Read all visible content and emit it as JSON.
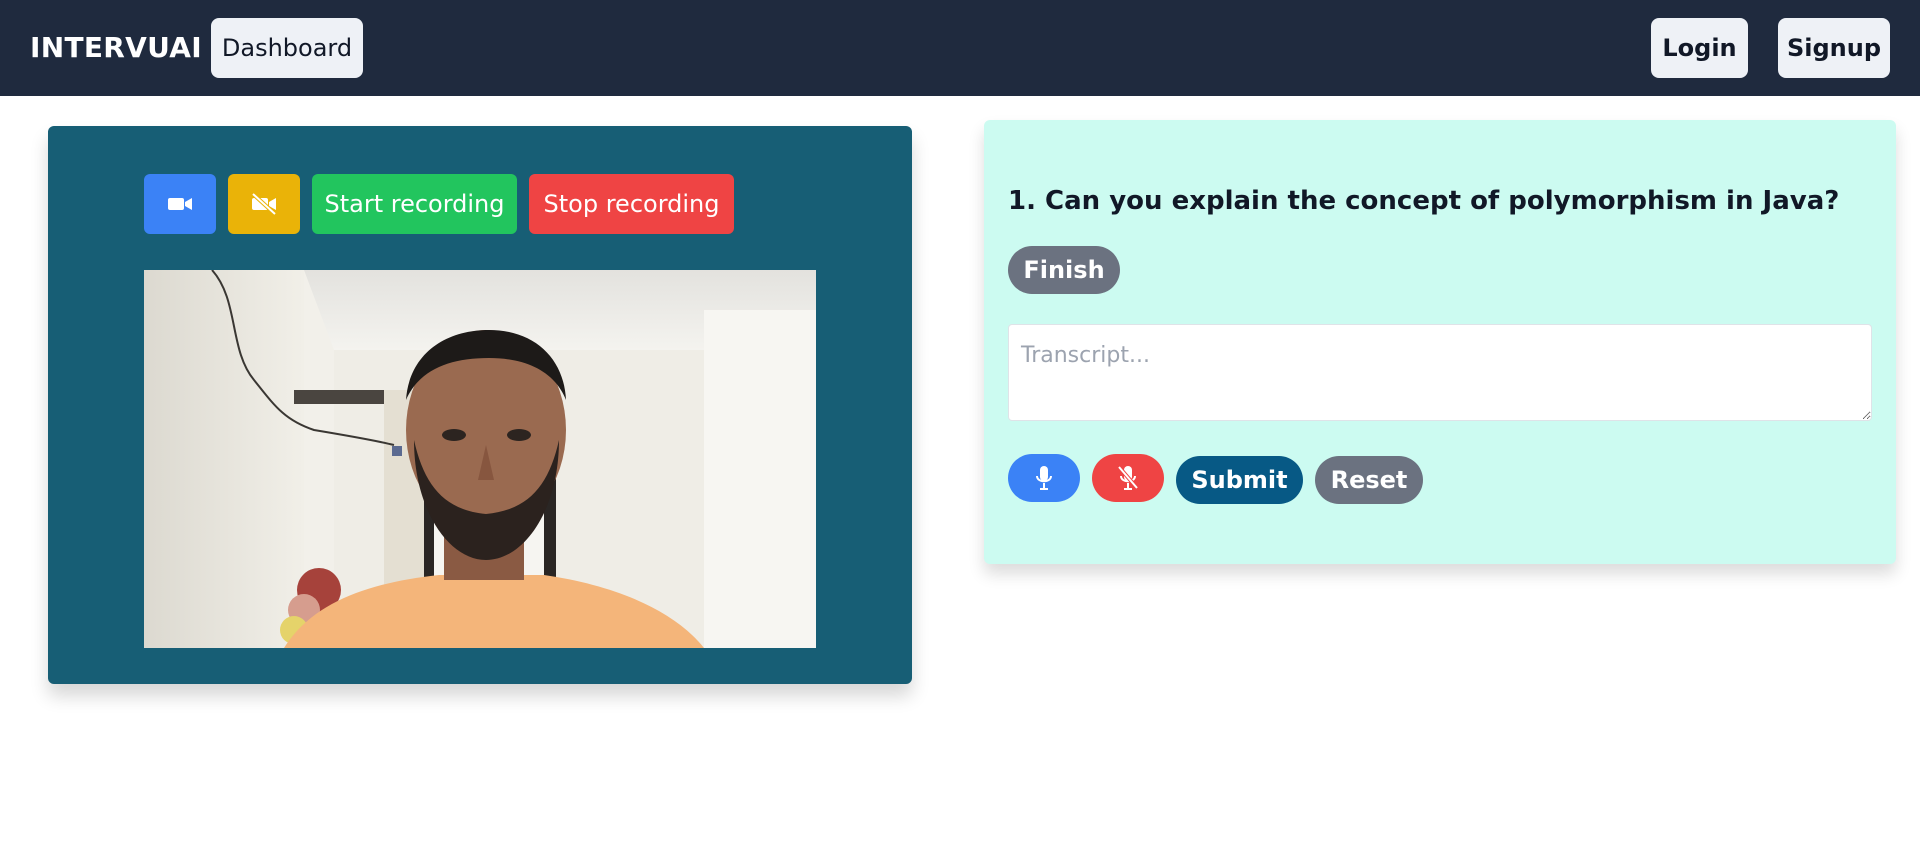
{
  "navbar": {
    "brand": "INTERVUAI",
    "dashboard_label": "Dashboard",
    "login_label": "Login",
    "signup_label": "Signup",
    "background": "#1f2a3e"
  },
  "video_panel": {
    "background": "#175e75",
    "camera_on_icon": "video-camera-icon",
    "camera_off_icon": "video-camera-off-icon",
    "start_recording_label": "Start recording",
    "stop_recording_label": "Stop recording",
    "feed_description": "webcam-feed"
  },
  "question_panel": {
    "background": "#ccfbf1",
    "question": "1. Can you explain the concept of polymorphism in Java?",
    "finish_label": "Finish",
    "transcript_placeholder": "Transcript...",
    "mic_on_icon": "microphone-icon",
    "mic_off_icon": "microphone-off-icon",
    "submit_label": "Submit",
    "reset_label": "Reset"
  },
  "colors": {
    "primary_blue": "#3b82f6",
    "yellow": "#eab308",
    "green": "#22c55e",
    "red": "#ef4444",
    "gray": "#6b7280",
    "dark_blue": "#075985"
  }
}
